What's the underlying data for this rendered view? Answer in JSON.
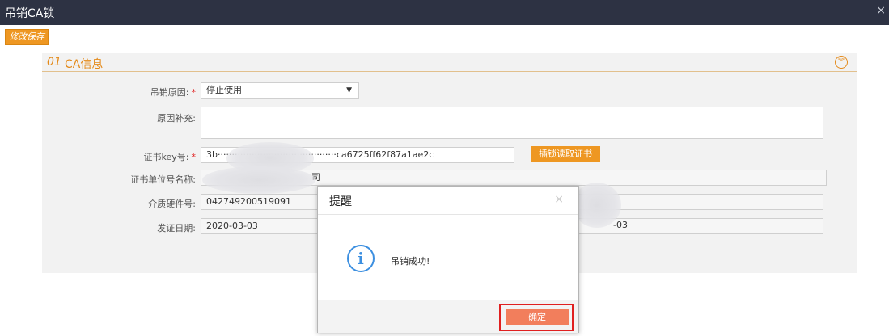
{
  "window": {
    "title": "吊销CA锁",
    "close_glyph": "×"
  },
  "toolbar": {
    "save_label": "修改保存"
  },
  "section": {
    "number": "01",
    "title": "CA信息"
  },
  "form": {
    "reason": {
      "label": "吊销原因:",
      "value": "停止使用"
    },
    "reason_extra": {
      "label": "原因补充:",
      "value": ""
    },
    "cert_key": {
      "label": "证书key号:",
      "value": "3b··········································ca6725ff62f87a1ae2c"
    },
    "read_button_label": "插锁读取证书",
    "cert_unit": {
      "label": "证书单位号名称:",
      "value": "司"
    },
    "media_hw": {
      "label": "介质硬件号:",
      "value": "042749200519091"
    },
    "issue_date": {
      "label": "发证日期:",
      "value": "2020-03-03"
    },
    "expire_date_tail": "-03"
  },
  "dialog": {
    "title": "提醒",
    "close_glyph": "×",
    "icon": "info-icon",
    "message": "吊销成功!",
    "ok_label": "确定"
  },
  "colors": {
    "titlebar": "#2d3243",
    "accent": "#ee9722",
    "section_title": "#e48a1a",
    "ok_button": "#f27e5c",
    "highlight": "#e02020",
    "info_icon": "#3c8fe0"
  }
}
